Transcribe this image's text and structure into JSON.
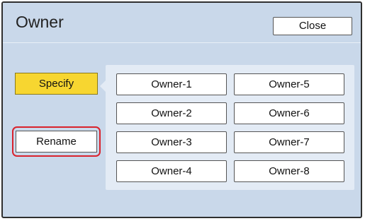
{
  "header": {
    "title": "Owner",
    "close_label": "Close"
  },
  "actions": {
    "specify_label": "Specify",
    "rename_label": "Rename"
  },
  "owners": [
    "Owner-1",
    "Owner-2",
    "Owner-3",
    "Owner-4",
    "Owner-5",
    "Owner-6",
    "Owner-7",
    "Owner-8"
  ],
  "colors": {
    "background": "#c9d8ea",
    "panel": "#e3ebf5",
    "specify_active": "#f7d630",
    "highlight_outline": "#d9232d"
  }
}
